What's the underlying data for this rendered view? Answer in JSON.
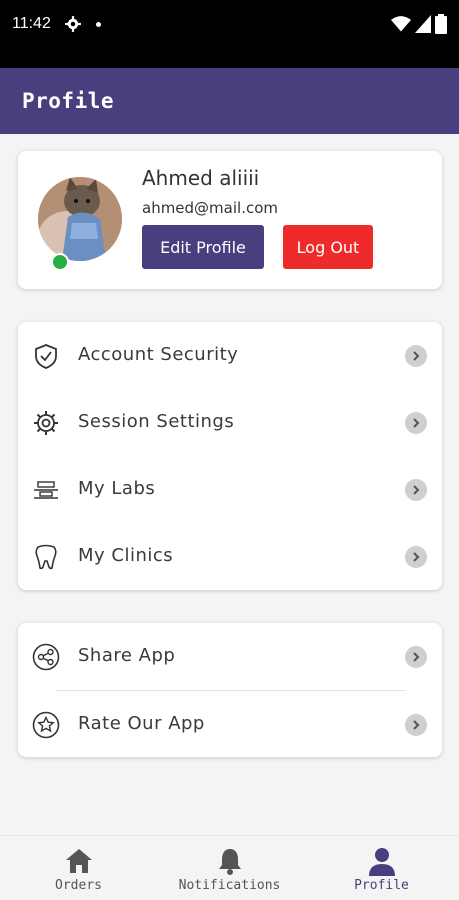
{
  "status_bar": {
    "time": "11:42"
  },
  "app_bar": {
    "title": "Profile"
  },
  "profile": {
    "name": "Ahmed aliiii",
    "email": "ahmed@mail.com",
    "edit_label": "Edit Profile",
    "logout_label": "Log Out",
    "online": true
  },
  "menu_main": [
    {
      "label": "Account Security",
      "icon": "shield-check-icon"
    },
    {
      "label": "Session Settings",
      "icon": "gear-icon"
    },
    {
      "label": "My Labs",
      "icon": "lab-icon"
    },
    {
      "label": "My Clinics",
      "icon": "tooth-icon"
    }
  ],
  "menu_extra": [
    {
      "label": "Share App",
      "icon": "share-icon"
    },
    {
      "label": "Rate Our App",
      "icon": "star-icon"
    }
  ],
  "bottom_nav": [
    {
      "label": "Orders",
      "icon": "home-icon",
      "active": false
    },
    {
      "label": "Notifications",
      "icon": "bell-icon",
      "active": false
    },
    {
      "label": "Profile",
      "icon": "person-icon",
      "active": true
    }
  ],
  "colors": {
    "primary": "#4a3f7e",
    "danger": "#ee2a2a",
    "online": "#27ae45"
  }
}
